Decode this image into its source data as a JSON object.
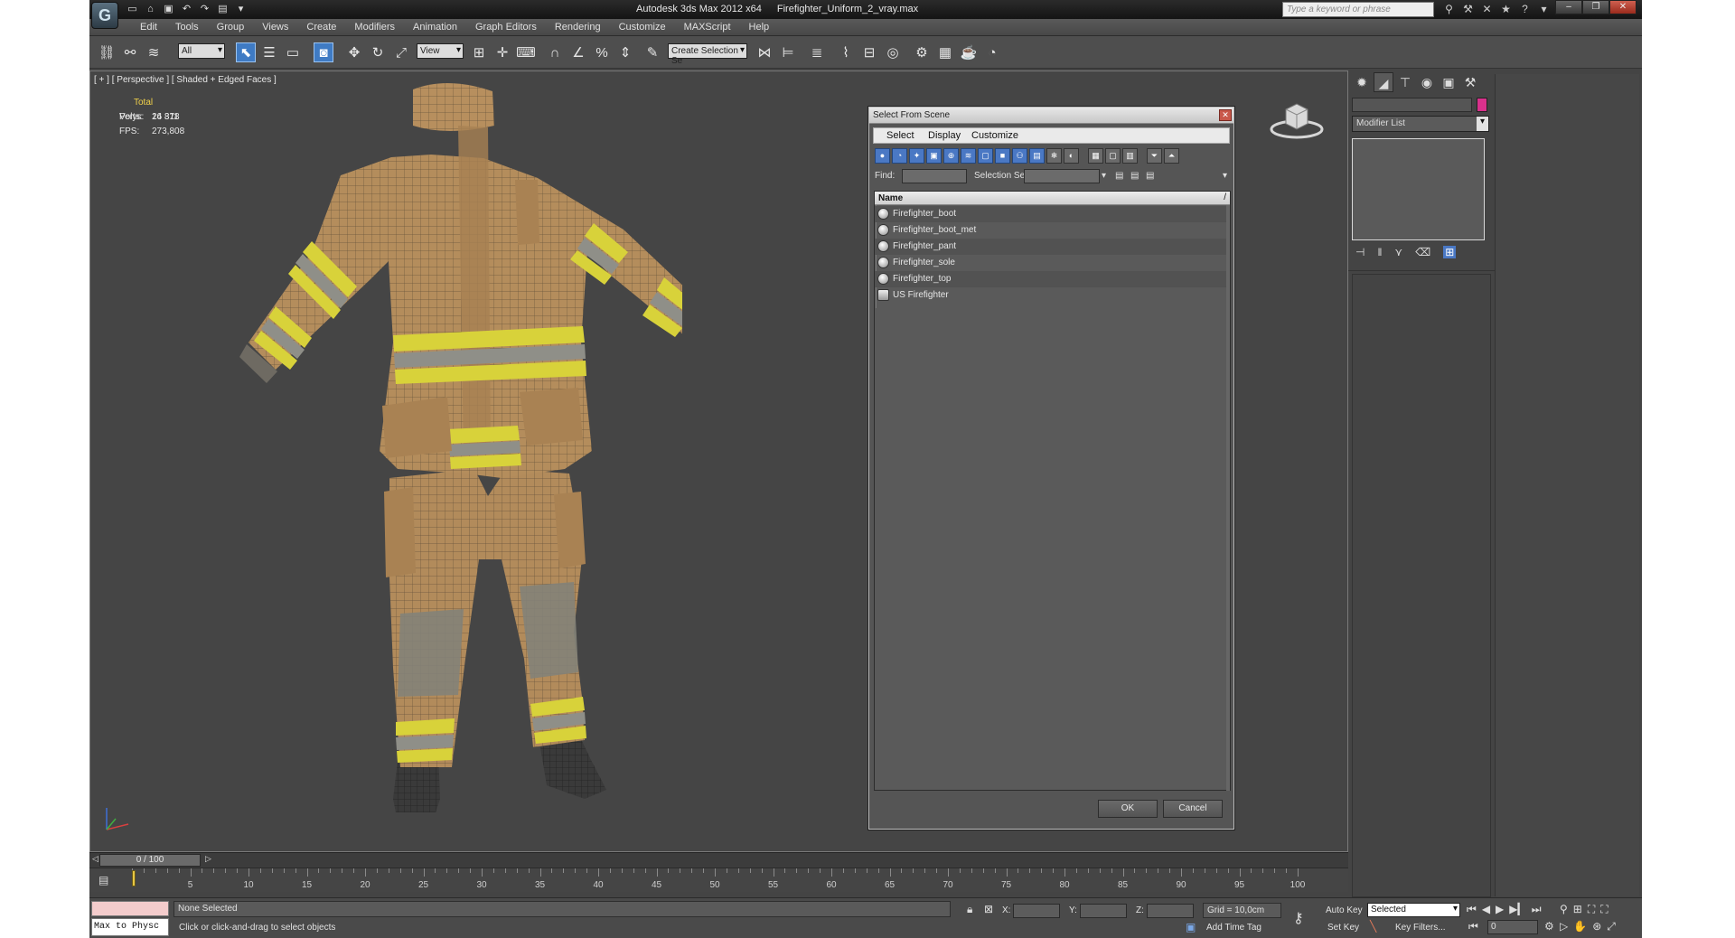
{
  "title": {
    "app": "Autodesk 3ds Max  2012 x64",
    "file": "Firefighter_Uniform_2_vray.max",
    "search_placeholder": "Type a keyword or phrase"
  },
  "menu": [
    "Edit",
    "Tools",
    "Group",
    "Views",
    "Create",
    "Modifiers",
    "Animation",
    "Graph Editors",
    "Rendering",
    "Customize",
    "MAXScript",
    "Help"
  ],
  "toolbar": {
    "filter": "All",
    "ref_coord": "View",
    "selection_set": "Create Selection Se"
  },
  "viewport": {
    "label": "[ + ] [ Perspective ] [ Shaded + Edged Faces ]",
    "stats": {
      "total_label": "Total",
      "polys_label": "Polys:",
      "polys": "24 378",
      "verts_label": "Verts:",
      "verts": "16 811",
      "fps_label": "FPS:",
      "fps": "273,808"
    }
  },
  "dialog": {
    "title": "Select From Scene",
    "menu": [
      "Select",
      "Display",
      "Customize"
    ],
    "find_label": "Find:",
    "selset_label": "Selection Set:",
    "column": "Name",
    "items": [
      "Firefighter_boot",
      "Firefighter_boot_met",
      "Firefighter_pant",
      "Firefighter_sole",
      "Firefighter_top",
      "US Firefighter"
    ],
    "ok": "OK",
    "cancel": "Cancel"
  },
  "command_panel": {
    "modifier_list": "Modifier List"
  },
  "timeline": {
    "slider": "0 / 100",
    "ticks": [
      "5",
      "10",
      "15",
      "20",
      "25",
      "30",
      "35",
      "40",
      "45",
      "50",
      "55",
      "60",
      "65",
      "70",
      "75",
      "80",
      "85",
      "90",
      "95",
      "100"
    ]
  },
  "status": {
    "maxscript": "Max to Physc",
    "selection": "None Selected",
    "prompt": "Click or click-and-drag to select objects",
    "x_label": "X:",
    "y_label": "Y:",
    "z_label": "Z:",
    "grid": "Grid = 10,0cm",
    "add_time_tag": "Add Time Tag",
    "auto_key": "Auto Key",
    "set_key": "Set Key",
    "key_mode": "Selected",
    "key_filters": "Key Filters...",
    "frame": "0"
  },
  "colors": {
    "accent": "#3f7bc4",
    "stats": "#f2d24a",
    "swatch": "#d9318c",
    "suit": "#b08a5a",
    "reflective_yellow": "#d8d23a",
    "reflective_grey": "#8f8f88"
  }
}
